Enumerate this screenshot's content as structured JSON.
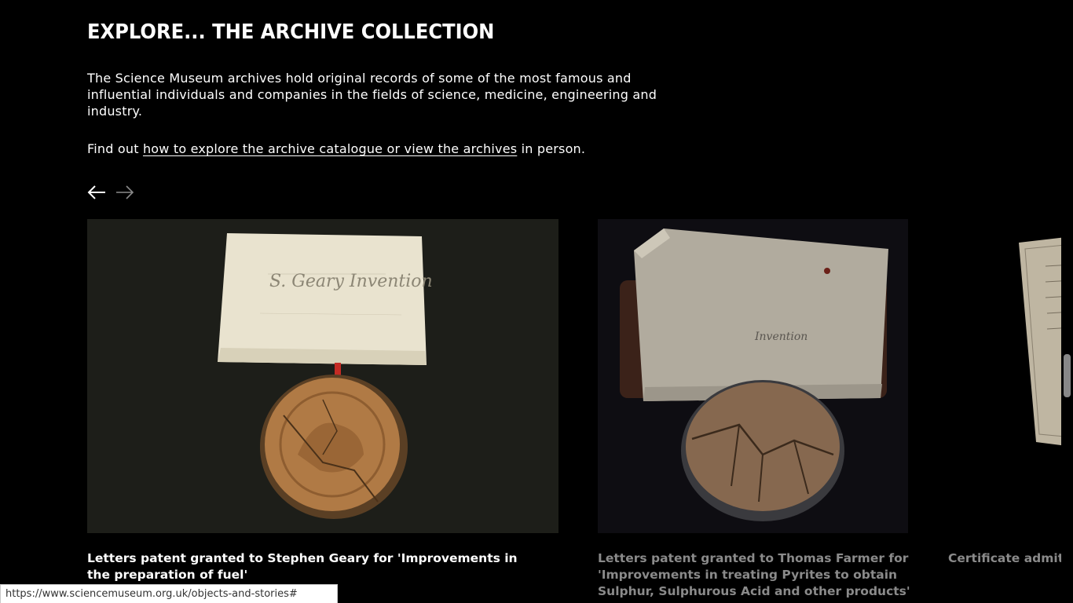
{
  "section": {
    "heading": "EXPLORE... THE ARCHIVE COLLECTION",
    "intro": "The Science Museum archives hold original records of some of the most famous and influential individuals and companies in the fields of science, medicine, engineering and industry.",
    "findout_prefix": "Find out ",
    "findout_link": "how to explore the archive catalogue or view the archives",
    "findout_suffix": " in person."
  },
  "carousel": {
    "prev_icon": "arrow-left-icon",
    "next_icon": "arrow-right-icon",
    "cards": [
      {
        "title": "Letters patent granted to Stephen Geary for 'Improvements in the preparation of fuel'",
        "image_text": "S. Geary Invention"
      },
      {
        "title": "Letters patent granted to Thomas Farmer for 'Improvements in treating Pyrites to obtain Sulphur, Sulphurous Acid and other products'",
        "image_text": "Invention"
      },
      {
        "title": "Certificate admitt… Medicine at the U…"
      }
    ]
  },
  "status_bar": {
    "url": "https://www.sciencemuseum.org.uk/objects-and-stories#"
  },
  "colors": {
    "background": "#000000",
    "text": "#ffffff",
    "inactive_title": "#8a8a8a"
  }
}
